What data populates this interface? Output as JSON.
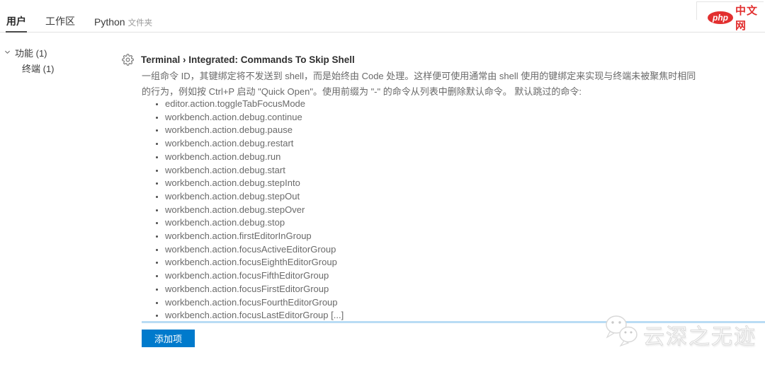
{
  "colors": {
    "accent_blue": "#007acc",
    "separator_blue": "#b9dcf4",
    "logo_red": "#e22f2f",
    "active_tab_underline": "#4a4a4a"
  },
  "logo": {
    "badge": "php",
    "site": "中文网"
  },
  "tabs": {
    "items": [
      {
        "label": "用户",
        "active": true
      },
      {
        "label": "工作区",
        "active": false
      },
      {
        "label": "Python",
        "suffix": "文件夹",
        "active": false
      }
    ]
  },
  "sidebar": {
    "items": [
      {
        "label": "功能 (1)"
      },
      {
        "label": "终端 (1)"
      }
    ]
  },
  "setting": {
    "category": "Terminal › Integrated: ",
    "name": "Commands To Skip Shell",
    "description": "一组命令 ID，其键绑定将不发送到 shell，而是始终由 Code 处理。这样便可使用通常由 shell 使用的键绑定来实现与终端未被聚焦时相同的行为，例如按 Ctrl+P 启动 \"Quick Open\"。使用前缀为 \"-\" 的命令从列表中删除默认命令。 默认跳过的命令:",
    "commands": [
      "editor.action.toggleTabFocusMode",
      "workbench.action.debug.continue",
      "workbench.action.debug.pause",
      "workbench.action.debug.restart",
      "workbench.action.debug.run",
      "workbench.action.debug.start",
      "workbench.action.debug.stepInto",
      "workbench.action.debug.stepOut",
      "workbench.action.debug.stepOver",
      "workbench.action.debug.stop",
      "workbench.action.firstEditorInGroup",
      "workbench.action.focusActiveEditorGroup",
      "workbench.action.focusEighthEditorGroup",
      "workbench.action.focusFifthEditorGroup",
      "workbench.action.focusFirstEditorGroup",
      "workbench.action.focusFourthEditorGroup",
      "workbench.action.focusLastEditorGroup [...]"
    ],
    "add_button_label": "添加项"
  },
  "icons": {
    "gear": "gear-icon",
    "chevron": "chevron-down-icon",
    "wechat": "wechat-icon"
  },
  "watermark": {
    "text": "云深之无迹"
  }
}
